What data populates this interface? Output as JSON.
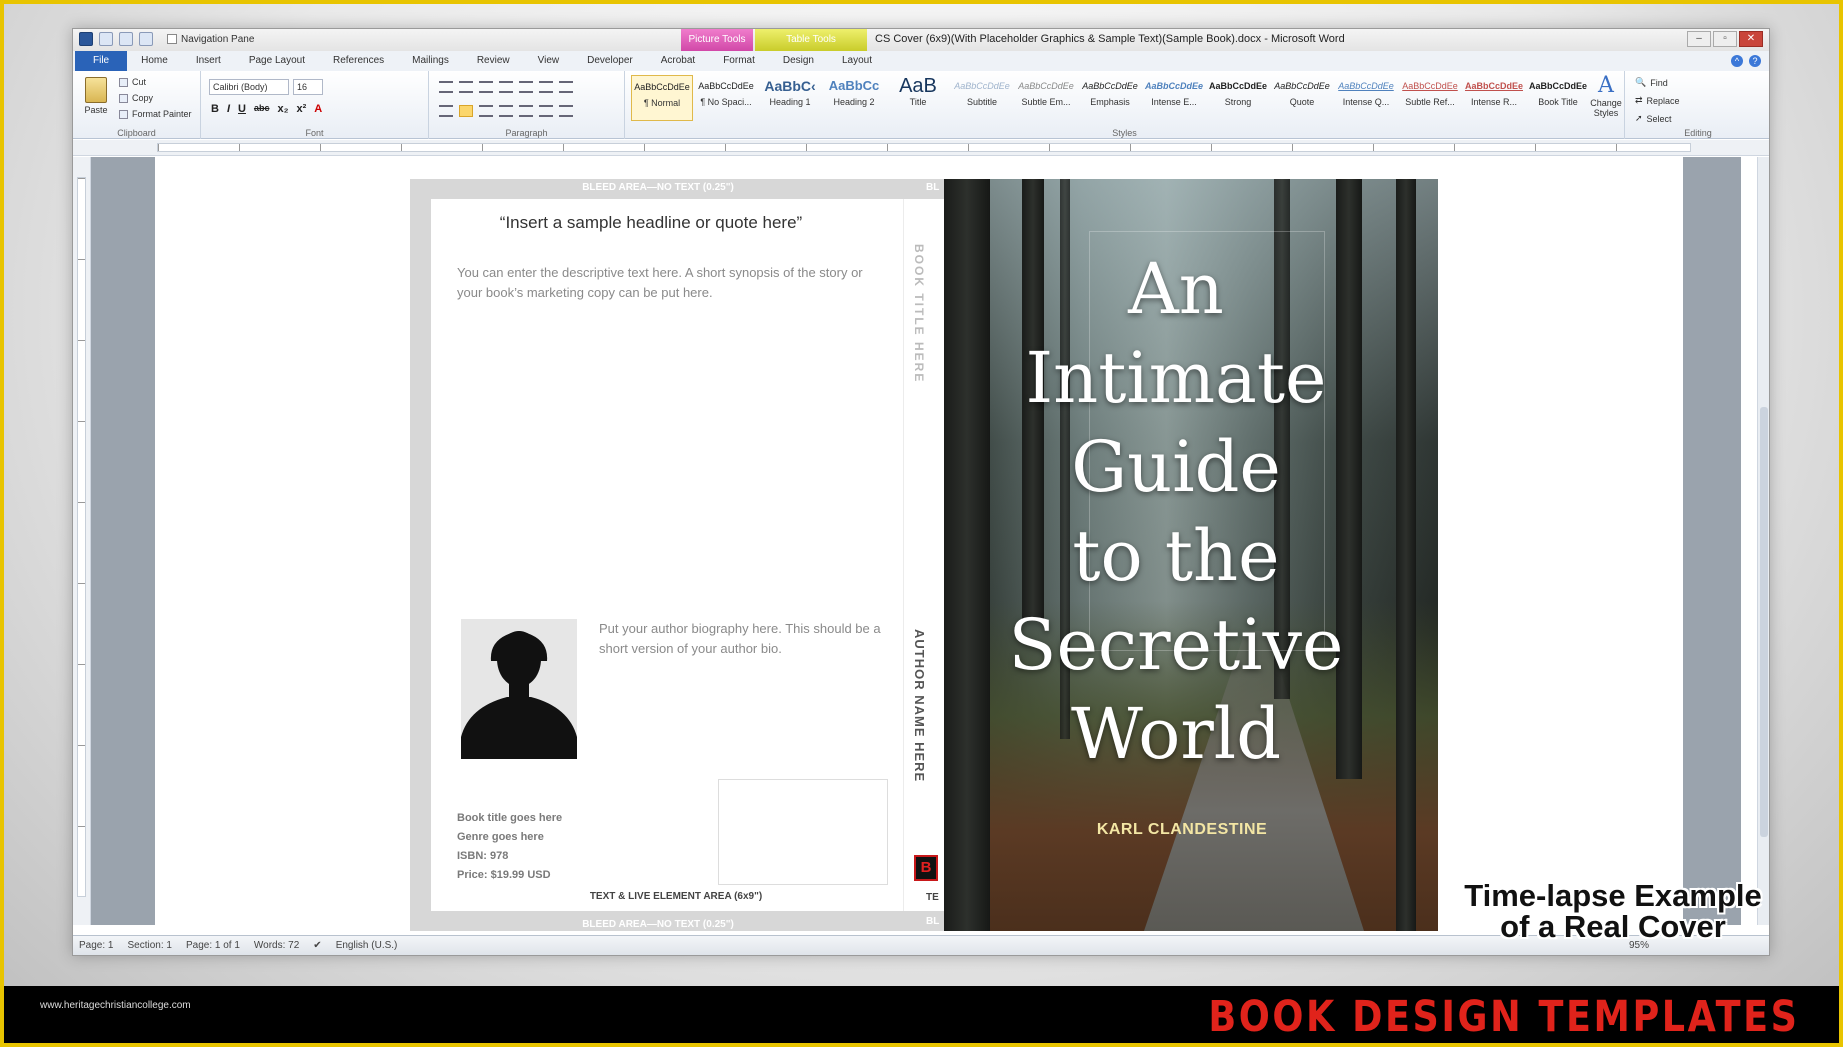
{
  "titlebar": {
    "quick_access": [
      "save-icon",
      "undo-icon",
      "redo-icon"
    ],
    "nav_pane_label": "Navigation Pane",
    "context_picture": "Picture Tools",
    "context_table": "Table Tools",
    "window_title": "CS Cover (6x9)(With Placeholder Graphics & Sample Text)(Sample Book).docx - Microsoft Word"
  },
  "tabs": [
    "File",
    "Home",
    "Insert",
    "Page Layout",
    "References",
    "Mailings",
    "Review",
    "View",
    "Developer",
    "Acrobat",
    "Format",
    "Design",
    "Layout"
  ],
  "ribbon": {
    "clipboard": {
      "paste": "Paste",
      "cut": "Cut",
      "copy": "Copy",
      "format_painter": "Format Painter",
      "label": "Clipboard"
    },
    "font": {
      "family": "Calibri (Body)",
      "size": "16",
      "label": "Font",
      "buttons": [
        "B",
        "I",
        "U",
        "abc",
        "x₂",
        "x²",
        "A"
      ]
    },
    "paragraph": {
      "label": "Paragraph"
    },
    "styles": {
      "label": "Styles",
      "items": [
        {
          "preview": "AaBbCcDdEe",
          "name": "¶ Normal"
        },
        {
          "preview": "AaBbCcDdEe",
          "name": "¶ No Spaci..."
        },
        {
          "preview": "AaBbC‹",
          "name": "Heading 1"
        },
        {
          "preview": "AaBbCc",
          "name": "Heading 2"
        },
        {
          "preview": "AaB",
          "name": "Title"
        },
        {
          "preview": "AaBbCcDdEe",
          "name": "Subtitle"
        },
        {
          "preview": "AaBbCcDdEe",
          "name": "Subtle Em..."
        },
        {
          "preview": "AaBbCcDdEe",
          "name": "Emphasis"
        },
        {
          "preview": "AaBbCcDdEe",
          "name": "Intense E..."
        },
        {
          "preview": "AaBbCcDdEe",
          "name": "Strong"
        },
        {
          "preview": "AaBbCcDdEe",
          "name": "Quote"
        },
        {
          "preview": "AaBbCcDdEe",
          "name": "Intense Q..."
        },
        {
          "preview": "AaBbCcDdEe",
          "name": "Subtle Ref..."
        },
        {
          "preview": "AaBbCcDdEe",
          "name": "Intense R..."
        },
        {
          "preview": "AaBbCcDdEe",
          "name": "Book Title"
        }
      ],
      "change_styles": "Change Styles"
    },
    "editing": {
      "label": "Editing",
      "find": "Find",
      "replace": "Replace",
      "select": "Select"
    }
  },
  "cover": {
    "bleed_top": "BLEED AREA—NO TEXT (0.25\")",
    "bleed_bottom": "BLEED AREA—NO TEXT (0.25\")",
    "spine_cut_top": "BL",
    "spine_cut_bottom": "BL",
    "spine_cut_text": "TE",
    "headline": "“Insert a sample headline or quote here”",
    "description": "You can enter the descriptive text here. A short synopsis of the story or your book’s marketing copy can be put here.",
    "bio": "Put your author biography here. This should be a short version of your author bio.",
    "meta": [
      "Book title goes here",
      "Genre goes here",
      "ISBN: 978",
      "Price: $19.99  USD"
    ],
    "text_area_label": "TEXT & LIVE ELEMENT AREA (6x9\")",
    "spine_title": "BOOK TITLE HERE",
    "spine_author": "AUTHOR NAME HERE",
    "publisher_mark": "B",
    "front_title": [
      "An",
      "Intimate",
      "Guide",
      "to the",
      "Secretive",
      "World"
    ],
    "front_author": "KARL CLANDESTINE"
  },
  "statusbar": {
    "page": "Page: 1",
    "section": "Section: 1",
    "page_of": "Page: 1 of 1",
    "words": "Words: 72",
    "language": "English (U.S.)",
    "zoom": "95%"
  },
  "overlay": {
    "caption_line1": "Time-lapse Example",
    "caption_line2": "of a Real Cover",
    "url": "www.heritagechristiancollege.com",
    "brand": "BOOK DESIGN TEMPLATES"
  }
}
